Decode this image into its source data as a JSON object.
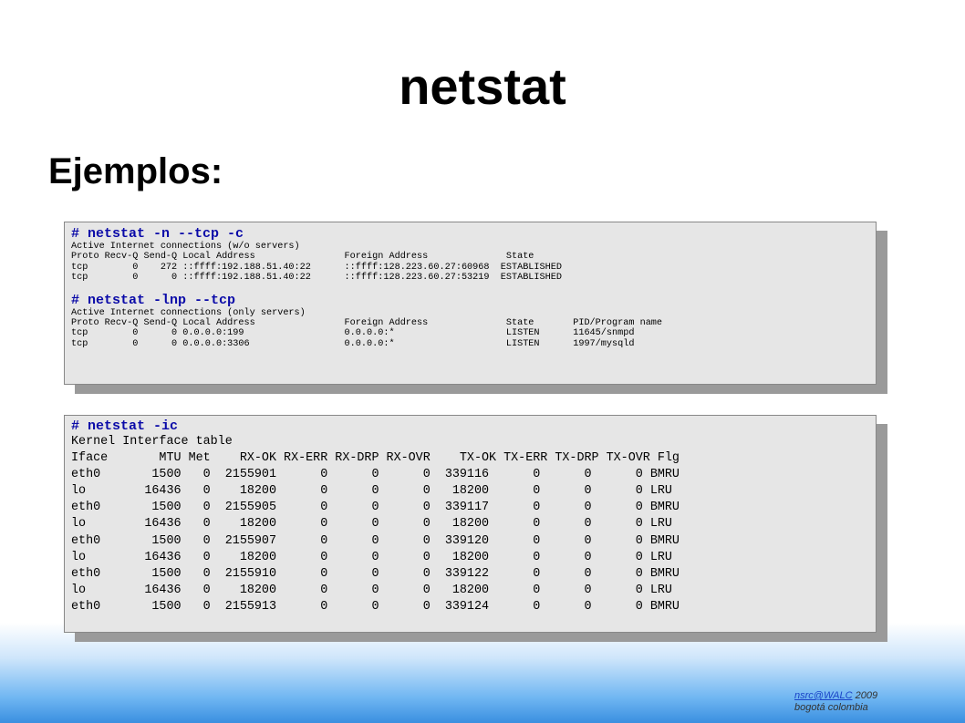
{
  "slide": {
    "title": "netstat",
    "subtitle": "Ejemplos:"
  },
  "panel1": {
    "cmd1": "# netstat -n --tcp -c",
    "block1": [
      "Active Internet connections (w/o servers)",
      "Proto Recv-Q Send-Q Local Address                Foreign Address              State",
      "tcp        0    272 ::ffff:192.188.51.40:22      ::ffff:128.223.60.27:60968  ESTABLISHED",
      "tcp        0      0 ::ffff:192.188.51.40:22      ::ffff:128.223.60.27:53219  ESTABLISHED"
    ],
    "cmd2": "# netstat -lnp --tcp",
    "block2": [
      "Active Internet connections (only servers)",
      "Proto Recv-Q Send-Q Local Address                Foreign Address              State       PID/Program name",
      "tcp        0      0 0.0.0.0:199                  0.0.0.0:*                    LISTEN      11645/snmpd",
      "tcp        0      0 0.0.0.0:3306                 0.0.0.0:*                    LISTEN      1997/mysqld"
    ]
  },
  "panel2": {
    "cmd": "# netstat -ic",
    "lines": [
      "Kernel Interface table",
      "Iface       MTU Met    RX-OK RX-ERR RX-DRP RX-OVR    TX-OK TX-ERR TX-DRP TX-OVR Flg",
      "eth0       1500   0  2155901      0      0      0  339116      0      0      0 BMRU",
      "lo        16436   0    18200      0      0      0   18200      0      0      0 LRU",
      "eth0       1500   0  2155905      0      0      0  339117      0      0      0 BMRU",
      "lo        16436   0    18200      0      0      0   18200      0      0      0 LRU",
      "eth0       1500   0  2155907      0      0      0  339120      0      0      0 BMRU",
      "lo        16436   0    18200      0      0      0   18200      0      0      0 LRU",
      "eth0       1500   0  2155910      0      0      0  339122      0      0      0 BMRU",
      "lo        16436   0    18200      0      0      0   18200      0      0      0 LRU",
      "eth0       1500   0  2155913      0      0      0  339124      0      0      0 BMRU"
    ]
  },
  "footer": {
    "link": "nsrc@WALC",
    "year": " 2009",
    "location": "bogotá colombia"
  }
}
